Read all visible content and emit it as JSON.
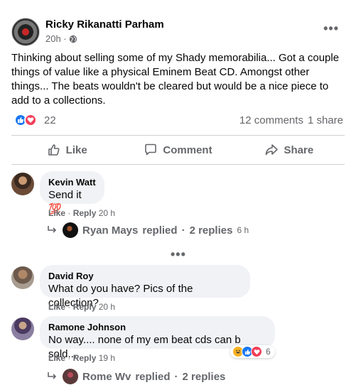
{
  "post": {
    "author": "Ricky Rikanatti Parham",
    "time": "20h ·",
    "more_glyph": "•••",
    "text": "Thinking about selling some of my Shady memorabilia... Got a couple things of value like a physical Eminem Beat CD. Amongst other things... The beats wouldn't be cleared but would be a nice piece to add to a collections.",
    "reaction_count": "22",
    "comments_count": "12 comments",
    "shares_count": "1 share"
  },
  "actions": {
    "like": "Like",
    "comment": "Comment",
    "share": "Share"
  },
  "colors": {
    "like_blue": "#1877f2",
    "love_red": "#f33e58",
    "bubble_bg": "#f0f2f5",
    "secondary_text": "#65676b"
  },
  "comments": [
    {
      "name": "Kevin Watt",
      "text": "Send it 💯",
      "like": "Like",
      "reply": "Reply",
      "time": "20 h",
      "replies": {
        "name": "Ryan Mays",
        "replied": "replied",
        "count": "2 replies",
        "time": "6 h"
      }
    },
    {
      "name": "David Roy",
      "text": "What do you have? Pics of the collection?",
      "like": "Like",
      "reply": "Reply",
      "time": "20 h"
    },
    {
      "name": "Ramone Johnson",
      "text": "No way.... none of my em beat cds can b sold...",
      "like": "Like",
      "reply": "Reply",
      "time": "19 h",
      "reaction_count": "6",
      "replies": {
        "name": "Rome Wv",
        "replied": "replied",
        "count": "2 replies"
      }
    }
  ],
  "more_comments_glyph": "•••",
  "separator_dot": "·"
}
